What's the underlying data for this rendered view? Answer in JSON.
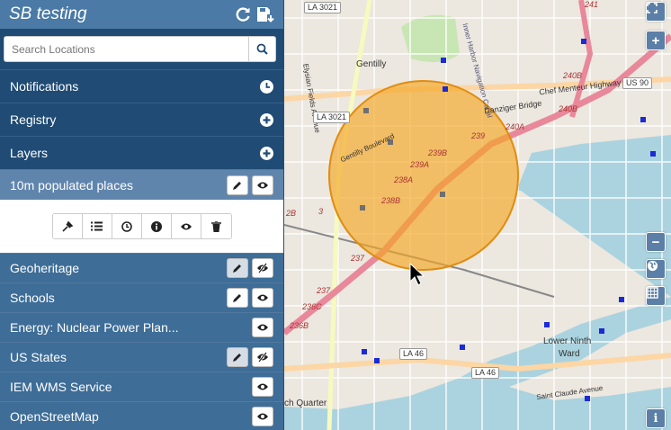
{
  "app": {
    "title": "SB testing"
  },
  "search": {
    "placeholder": "Search Locations"
  },
  "sections": {
    "notifications": "Notifications",
    "registry": "Registry",
    "layers": "Layers"
  },
  "layers": [
    {
      "label": "10m populated places",
      "selected": true,
      "visible": true
    },
    {
      "label": "Geoheritage",
      "visible": false
    },
    {
      "label": "Schools",
      "visible": true
    },
    {
      "label": "Energy: Nuclear Power Plan...",
      "visible": true
    },
    {
      "label": "US States",
      "visible": false
    },
    {
      "label": "IEM WMS Service",
      "visible": true
    },
    {
      "label": "OpenStreetMap",
      "visible": true
    }
  ],
  "layer_toolbar": [
    "pin-icon",
    "list-icon",
    "clock-icon",
    "info-icon",
    "eye-icon",
    "trash-icon"
  ],
  "map": {
    "labels": {
      "gentilly": "Gentilly",
      "elysian": "Elysian Fields Avenue",
      "chef": "Chef Menteur Highway",
      "danziger": "Danziger Bridge",
      "lower_ninth": "Lower Ninth",
      "ward": "Ward",
      "french_quarter": "ch Quarter",
      "st_claude": "Saint Claude Avenue",
      "boulevard": "Gentilly Boulevard",
      "canal": "Inner Harbor Navigation Canal"
    },
    "shields": {
      "la3021_top": "LA 3021",
      "la3021": "LA 3021",
      "us90": "US 90",
      "la46a": "LA 46",
      "la46b": "LA 46"
    },
    "exits": [
      "240B",
      "240B",
      "240A",
      "239",
      "239B",
      "239A",
      "238A",
      "238B",
      "237",
      "237",
      "236C",
      "236B",
      "2B",
      "3",
      "241"
    ],
    "colors": {
      "buffer": "#f5a623",
      "poi": "#1a2bd6",
      "motorway": "#e8889a"
    }
  }
}
